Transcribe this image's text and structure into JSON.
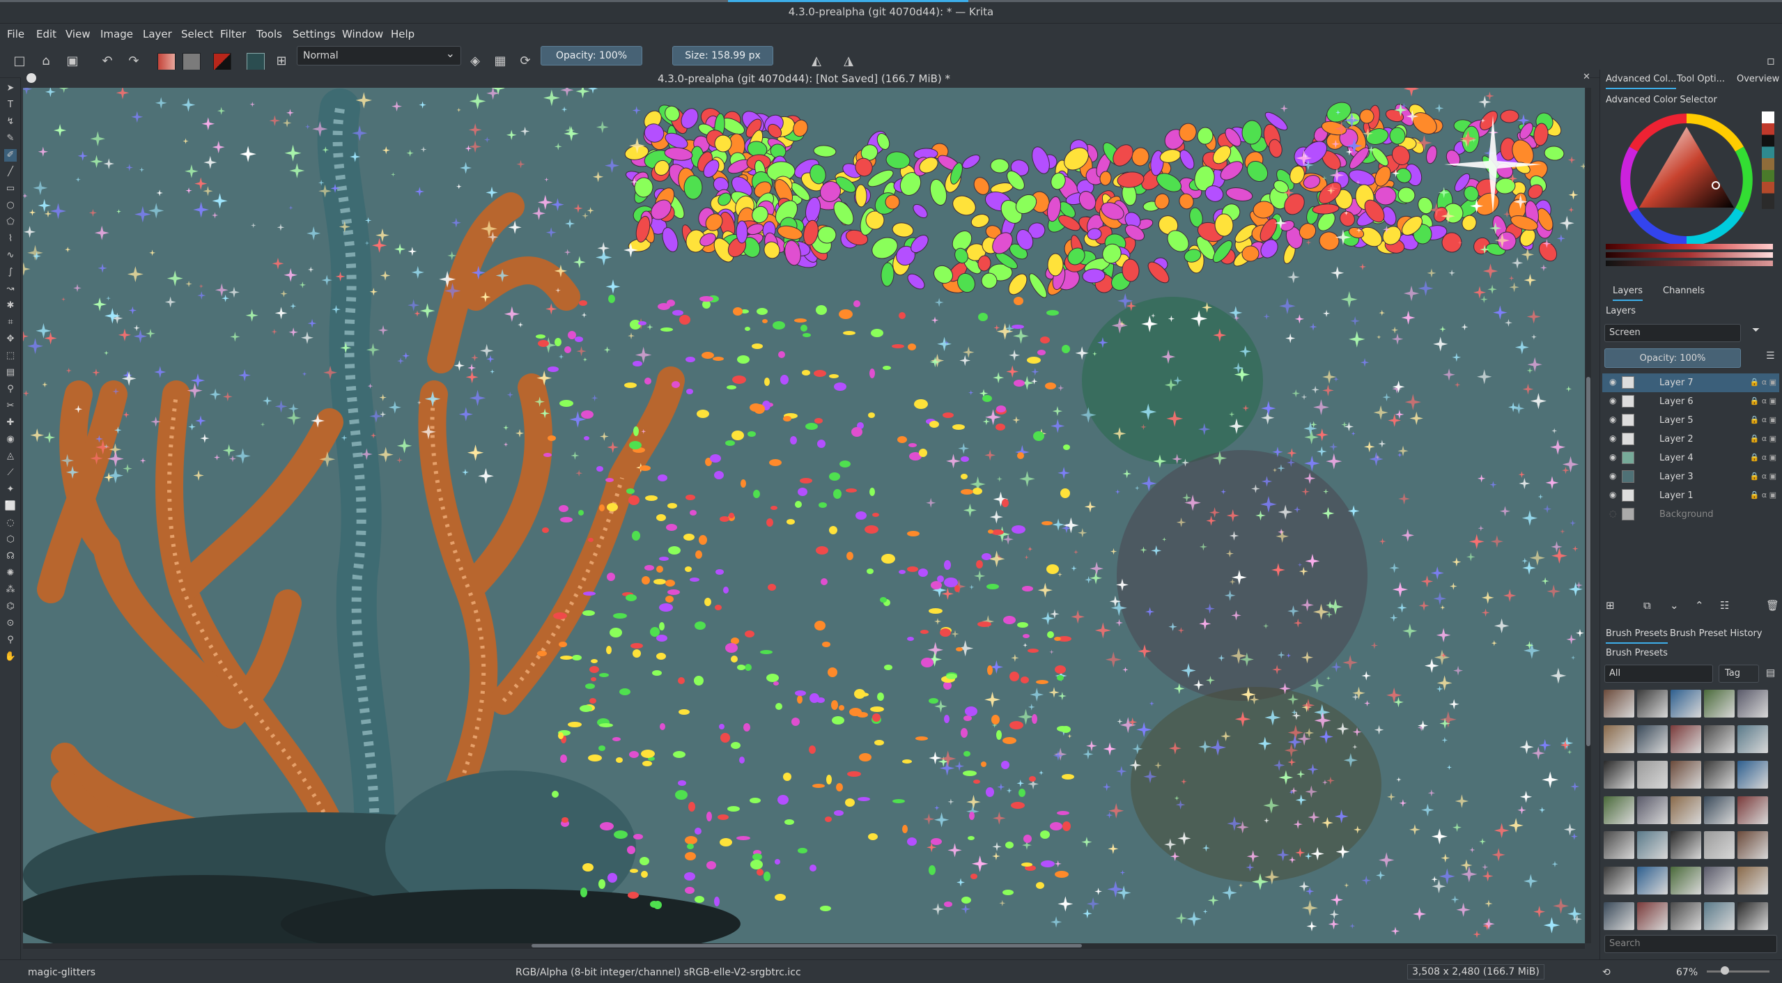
{
  "window": {
    "title": "4.3.0-prealpha (git 4070d44): * — Krita"
  },
  "menu": [
    "File",
    "Edit",
    "View",
    "Image",
    "Layer",
    "Select",
    "Filter",
    "Tools",
    "Settings",
    "Window",
    "Help"
  ],
  "toolbar": {
    "blend_mode": "Normal",
    "opacity_label": "Opacity: 100%",
    "size_label": "Size: 158.99 px"
  },
  "canvas": {
    "document_title": "4.3.0-prealpha (git 4070d44):  [Not Saved]  (166.7 MiB) *"
  },
  "dock_tabs": [
    "Advanced Col...",
    "Tool Opti...",
    "Overview"
  ],
  "color_selector": {
    "title": "Advanced Color Selector"
  },
  "layers_panel": {
    "tabs": [
      "Layers",
      "Channels"
    ],
    "title": "Layers",
    "blend_mode": "Screen",
    "opacity_label": "Opacity:  100%",
    "layers": [
      {
        "name": "Layer 7",
        "selected": true
      },
      {
        "name": "Layer 6",
        "selected": false
      },
      {
        "name": "Layer 5",
        "selected": false
      },
      {
        "name": "Layer 2",
        "selected": false
      },
      {
        "name": "Layer 4",
        "selected": false
      },
      {
        "name": "Layer 3",
        "selected": false
      },
      {
        "name": "Layer 1",
        "selected": false
      },
      {
        "name": "Background",
        "selected": false
      }
    ]
  },
  "brush_presets": {
    "tabs": [
      "Brush Presets",
      "Brush Preset History"
    ],
    "title": "Brush Presets",
    "filter": "All",
    "tag_label": "Tag",
    "search_placeholder": "Search"
  },
  "status": {
    "brush": "magic-glitters",
    "color_space": "RGB/Alpha (8-bit integer/channel)  sRGB-elle-V2-srgbtrc.icc",
    "dimensions": "3,508 x 2,480 (166.7 MiB)",
    "zoom": "67%"
  },
  "colors": {
    "accent": "#3daee9",
    "canvas_bg": "#4f7176",
    "selection": "#3b5f7a"
  }
}
